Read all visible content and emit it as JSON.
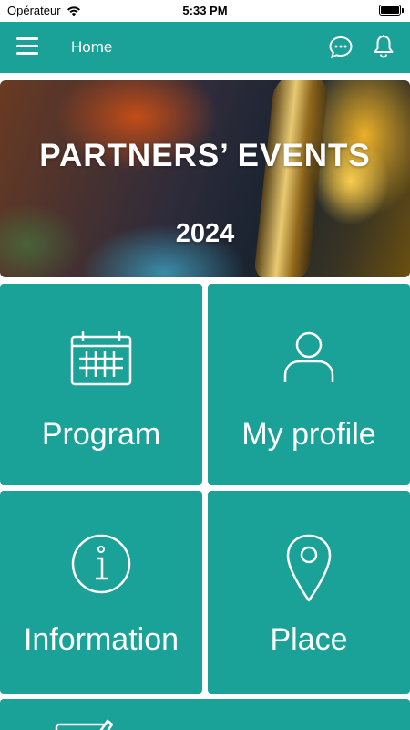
{
  "status_bar": {
    "carrier": "Opérateur",
    "time": "5:33 PM"
  },
  "header": {
    "title": "Home",
    "icons": [
      "menu-icon",
      "chat-icon",
      "bell-icon"
    ],
    "background": "#1aa198"
  },
  "banner": {
    "title": "PARTNERS’ EVENTS",
    "year": "2024"
  },
  "tiles": [
    {
      "label": "Program",
      "icon": "calendar-icon"
    },
    {
      "label": "My profile",
      "icon": "user-icon"
    },
    {
      "label": "Information",
      "icon": "info-icon"
    },
    {
      "label": "Place",
      "icon": "map-pin-icon"
    },
    {
      "label": "",
      "icon": "edit-icon"
    }
  ],
  "colors": {
    "accent": "#1aa198",
    "text_on_accent": "#ffffff"
  }
}
